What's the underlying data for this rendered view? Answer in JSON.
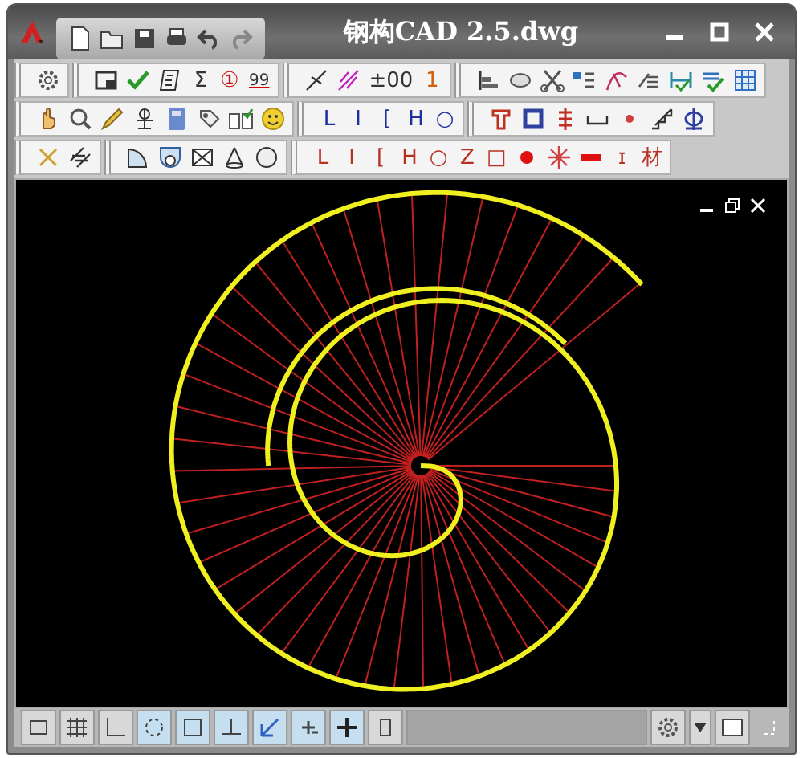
{
  "window": {
    "title": "钢构CAD 2.5.dwg"
  },
  "toolbar_rows": [
    {
      "labels": [
        "Σ",
        "①",
        "99",
        "±00",
        "1"
      ]
    },
    {
      "labels": [
        "L",
        "I",
        "[",
        "H",
        "○"
      ]
    },
    {
      "labels": [
        "L",
        "I",
        "[",
        "H",
        "○",
        "Z",
        "□",
        "ɪ",
        "材"
      ]
    }
  ]
}
